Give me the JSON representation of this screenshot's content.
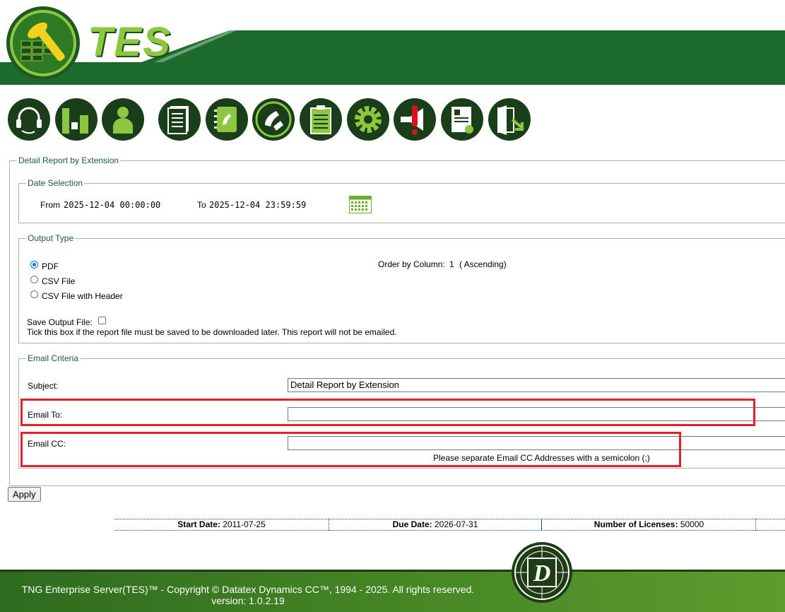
{
  "header": {
    "logo_text": "TES",
    "colors": {
      "band": "#1c6b2c",
      "logo_green": "#8dc63f"
    }
  },
  "toolbar": {
    "icons": [
      "headset-icon",
      "bar-chart-icon",
      "user-icon",
      "document-list-icon",
      "phone-book-icon",
      "phone-icon",
      "clipboard-icon",
      "gear-icon",
      "alert-megaphone-icon",
      "certificate-icon",
      "logout-door-icon"
    ]
  },
  "report": {
    "title": "Detail Report by Extension",
    "date_selection": {
      "legend": "Date Selection",
      "from_label": "From",
      "from_value": "2025-12-04 00:00:00",
      "to_label": "To",
      "to_value": "2025-12-04 23:59:59",
      "calendar_icon": "calendar-icon"
    },
    "output_type": {
      "legend": "Output Type",
      "options": [
        "PDF",
        "CSV File",
        "CSV File with Header"
      ],
      "selected": "PDF",
      "order_label": "Order by Column:",
      "order_value": "1",
      "order_dir": "( Ascending)",
      "save_label": "Save Output File:",
      "save_checked": false,
      "save_note": "Tick this box if the report file must be saved to be downloaded later. This report will not be emailed."
    },
    "email_criteria": {
      "legend": "Email Criteria",
      "subject_label": "Subject:",
      "subject_value": "Detail Report  by Extension",
      "email_to_label": "Email To:",
      "email_to_value": "",
      "email_cc_label": "Email CC:",
      "email_cc_value": "",
      "cc_note": "Please separate Email CC Addresses with a semicolon (;)"
    },
    "apply_label": "Apply"
  },
  "license_info": {
    "start_label": "Start Date:",
    "start_value": "2011-07-25",
    "due_label": "Due Date:",
    "due_value": "2026-07-31",
    "licenses_label": "Number of Licenses:",
    "licenses_value": "50000"
  },
  "footer": {
    "copyright": "TNG Enterprise Server(TES)™ - Copyright © Datatex Dynamics CC™, 1994 - 2025. All rights reserved.",
    "version": "version: 1.0.2.19",
    "logo_letter": "D"
  }
}
